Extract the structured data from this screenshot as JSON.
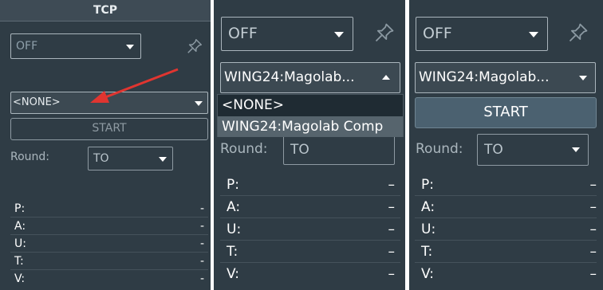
{
  "panels": [
    {
      "title": "TCP",
      "mode_select": {
        "value": "OFF"
      },
      "device_select": {
        "value": "<NONE>"
      },
      "start_label": "START",
      "round_label": "Round:",
      "round_select": {
        "value": "TO"
      },
      "rows": [
        {
          "label": "P:",
          "value": "-"
        },
        {
          "label": "A:",
          "value": "-"
        },
        {
          "label": "U:",
          "value": "-"
        },
        {
          "label": "T:",
          "value": "-"
        },
        {
          "label": "V:",
          "value": "-"
        }
      ]
    },
    {
      "mode_select": {
        "value": "OFF"
      },
      "device_select": {
        "value": "WING24:Magolab..."
      },
      "menu_items": [
        "<NONE>",
        "WING24:Magolab Comp"
      ],
      "round_label": "Round:",
      "round_select": {
        "value": "TO"
      },
      "rows": [
        {
          "label": "P:",
          "value": "–"
        },
        {
          "label": "A:",
          "value": "–"
        },
        {
          "label": "U:",
          "value": "–"
        },
        {
          "label": "T:",
          "value": "–"
        },
        {
          "label": "V:",
          "value": "–"
        }
      ]
    },
    {
      "mode_select": {
        "value": "OFF"
      },
      "device_select": {
        "value": "WING24:Magolab..."
      },
      "start_label": "START",
      "round_label": "Round:",
      "round_select": {
        "value": "TO"
      },
      "rows": [
        {
          "label": "P:",
          "value": "–"
        },
        {
          "label": "A:",
          "value": "–"
        },
        {
          "label": "U:",
          "value": "–"
        },
        {
          "label": "T:",
          "value": "–"
        },
        {
          "label": "V:",
          "value": "–"
        }
      ]
    }
  ],
  "icons": {
    "pin": "pin-icon",
    "arrow": "annotation-arrow"
  },
  "colors": {
    "panel_bg": "#2f3c45",
    "arrow": "#e03530",
    "button_active": "#4b6170"
  }
}
